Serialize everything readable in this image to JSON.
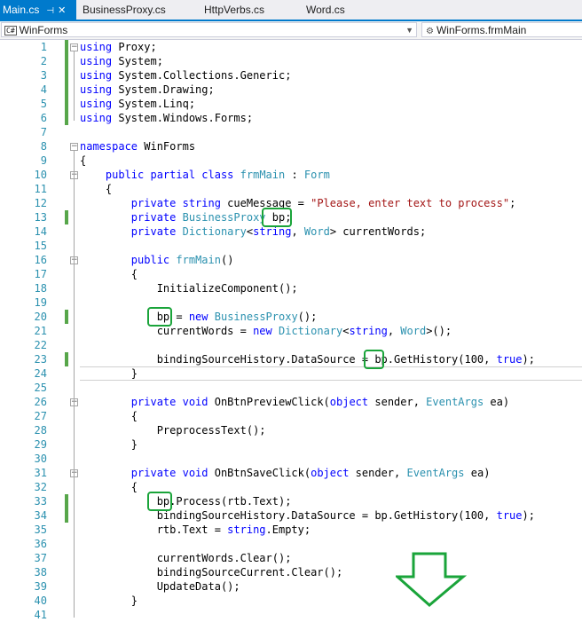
{
  "tabs": [
    {
      "label": "Main.cs",
      "active": true
    },
    {
      "label": "BusinessProxy.cs",
      "active": false
    },
    {
      "label": "HttpVerbs.cs",
      "active": false
    },
    {
      "label": "Word.cs",
      "active": false
    }
  ],
  "tab_pin_glyph": "⊣",
  "tab_close_glyph": "✕",
  "navbar": {
    "left_combo": {
      "icon": "C#",
      "value": "WinForms"
    },
    "right_combo": {
      "value": "WinForms.frmMain"
    }
  },
  "colors": {
    "keyword": "#0000ff",
    "type": "#2b91af",
    "string": "#a31515",
    "line_number": "#2b91af",
    "change_marker": "#57a64a",
    "highlight_box": "#1aa43a",
    "active_tab": "#007acc"
  },
  "code_lines": [
    {
      "n": "1",
      "tokens": [
        [
          "k",
          "using"
        ],
        [
          "p",
          " Proxy;"
        ]
      ]
    },
    {
      "n": "2",
      "tokens": [
        [
          "k",
          "using"
        ],
        [
          "p",
          " System;"
        ]
      ]
    },
    {
      "n": "3",
      "tokens": [
        [
          "k",
          "using"
        ],
        [
          "p",
          " System.Collections.Generic;"
        ]
      ]
    },
    {
      "n": "4",
      "tokens": [
        [
          "k",
          "using"
        ],
        [
          "p",
          " System.Drawing;"
        ]
      ]
    },
    {
      "n": "5",
      "tokens": [
        [
          "k",
          "using"
        ],
        [
          "p",
          " System.Linq;"
        ]
      ]
    },
    {
      "n": "6",
      "tokens": [
        [
          "k",
          "using"
        ],
        [
          "p",
          " System.Windows.Forms;"
        ]
      ]
    },
    {
      "n": "7",
      "tokens": []
    },
    {
      "n": "8",
      "tokens": [
        [
          "k",
          "namespace"
        ],
        [
          "p",
          " WinForms"
        ]
      ]
    },
    {
      "n": "9",
      "tokens": [
        [
          "p",
          "{"
        ]
      ]
    },
    {
      "n": "10",
      "tokens": [
        [
          "p",
          "    "
        ],
        [
          "k",
          "public partial class"
        ],
        [
          "p",
          " "
        ],
        [
          "t",
          "frmMain"
        ],
        [
          "p",
          " : "
        ],
        [
          "t",
          "Form"
        ]
      ]
    },
    {
      "n": "11",
      "tokens": [
        [
          "p",
          "    {"
        ]
      ]
    },
    {
      "n": "12",
      "tokens": [
        [
          "p",
          "        "
        ],
        [
          "k",
          "private string"
        ],
        [
          "p",
          " cueMessage = "
        ],
        [
          "s",
          "\"Please, enter text to process\""
        ],
        [
          "p",
          ";"
        ]
      ]
    },
    {
      "n": "13",
      "tokens": [
        [
          "p",
          "        "
        ],
        [
          "k",
          "private"
        ],
        [
          "p",
          " "
        ],
        [
          "t",
          "BusinessProxy"
        ],
        [
          "p",
          " bp;"
        ]
      ]
    },
    {
      "n": "14",
      "tokens": [
        [
          "p",
          "        "
        ],
        [
          "k",
          "private"
        ],
        [
          "p",
          " "
        ],
        [
          "t",
          "Dictionary"
        ],
        [
          "p",
          "<"
        ],
        [
          "k",
          "string"
        ],
        [
          "p",
          ", "
        ],
        [
          "t",
          "Word"
        ],
        [
          "p",
          "> currentWords;"
        ]
      ]
    },
    {
      "n": "15",
      "tokens": []
    },
    {
      "n": "16",
      "tokens": [
        [
          "p",
          "        "
        ],
        [
          "k",
          "public"
        ],
        [
          "p",
          " "
        ],
        [
          "t",
          "frmMain"
        ],
        [
          "p",
          "()"
        ]
      ]
    },
    {
      "n": "17",
      "tokens": [
        [
          "p",
          "        {"
        ]
      ]
    },
    {
      "n": "18",
      "tokens": [
        [
          "p",
          "            InitializeComponent();"
        ]
      ]
    },
    {
      "n": "19",
      "tokens": []
    },
    {
      "n": "20",
      "tokens": [
        [
          "p",
          "            bp = "
        ],
        [
          "k",
          "new"
        ],
        [
          "p",
          " "
        ],
        [
          "t",
          "BusinessProxy"
        ],
        [
          "p",
          "();"
        ]
      ]
    },
    {
      "n": "21",
      "tokens": [
        [
          "p",
          "            currentWords = "
        ],
        [
          "k",
          "new"
        ],
        [
          "p",
          " "
        ],
        [
          "t",
          "Dictionary"
        ],
        [
          "p",
          "<"
        ],
        [
          "k",
          "string"
        ],
        [
          "p",
          ", "
        ],
        [
          "t",
          "Word"
        ],
        [
          "p",
          ">();"
        ]
      ]
    },
    {
      "n": "22",
      "tokens": []
    },
    {
      "n": "23",
      "tokens": [
        [
          "p",
          "            bindingSourceHistory.DataSource = bp.GetHistory(100, "
        ],
        [
          "k",
          "true"
        ],
        [
          "p",
          ");"
        ]
      ]
    },
    {
      "n": "24",
      "tokens": [
        [
          "p",
          "        }"
        ]
      ]
    },
    {
      "n": "25",
      "tokens": []
    },
    {
      "n": "26",
      "tokens": [
        [
          "p",
          "        "
        ],
        [
          "k",
          "private void"
        ],
        [
          "p",
          " OnBtnPreviewClick("
        ],
        [
          "k",
          "object"
        ],
        [
          "p",
          " sender, "
        ],
        [
          "t",
          "EventArgs"
        ],
        [
          "p",
          " ea)"
        ]
      ]
    },
    {
      "n": "27",
      "tokens": [
        [
          "p",
          "        {"
        ]
      ]
    },
    {
      "n": "28",
      "tokens": [
        [
          "p",
          "            PreprocessText();"
        ]
      ]
    },
    {
      "n": "29",
      "tokens": [
        [
          "p",
          "        }"
        ]
      ]
    },
    {
      "n": "30",
      "tokens": []
    },
    {
      "n": "31",
      "tokens": [
        [
          "p",
          "        "
        ],
        [
          "k",
          "private void"
        ],
        [
          "p",
          " OnBtnSaveClick("
        ],
        [
          "k",
          "object"
        ],
        [
          "p",
          " sender, "
        ],
        [
          "t",
          "EventArgs"
        ],
        [
          "p",
          " ea)"
        ]
      ]
    },
    {
      "n": "32",
      "tokens": [
        [
          "p",
          "        {"
        ]
      ]
    },
    {
      "n": "33",
      "tokens": [
        [
          "p",
          "            bp.Process(rtb.Text);"
        ]
      ]
    },
    {
      "n": "34",
      "tokens": [
        [
          "p",
          "            bindingSourceHistory.DataSource = bp.GetHistory(100, "
        ],
        [
          "k",
          "true"
        ],
        [
          "p",
          ");"
        ]
      ]
    },
    {
      "n": "35",
      "tokens": [
        [
          "p",
          "            rtb.Text = "
        ],
        [
          "k",
          "string"
        ],
        [
          "p",
          ".Empty;"
        ]
      ]
    },
    {
      "n": "36",
      "tokens": []
    },
    {
      "n": "37",
      "tokens": [
        [
          "p",
          "            currentWords.Clear();"
        ]
      ]
    },
    {
      "n": "38",
      "tokens": [
        [
          "p",
          "            bindingSourceCurrent.Clear();"
        ]
      ]
    },
    {
      "n": "39",
      "tokens": [
        [
          "p",
          "            UpdateData();"
        ]
      ]
    },
    {
      "n": "40",
      "tokens": [
        [
          "p",
          "        }"
        ]
      ]
    },
    {
      "n": "41",
      "tokens": []
    }
  ],
  "changed_lines": [
    "1",
    "2",
    "3",
    "4",
    "5",
    "6",
    "13",
    "20",
    "23",
    "33",
    "34"
  ],
  "fold_lines": [
    "1",
    "8",
    "10",
    "16",
    "26",
    "31"
  ],
  "highlighted_lines": [
    "13",
    "20",
    "23",
    "33"
  ],
  "scroll_hint_icon": "down-arrow-icon"
}
